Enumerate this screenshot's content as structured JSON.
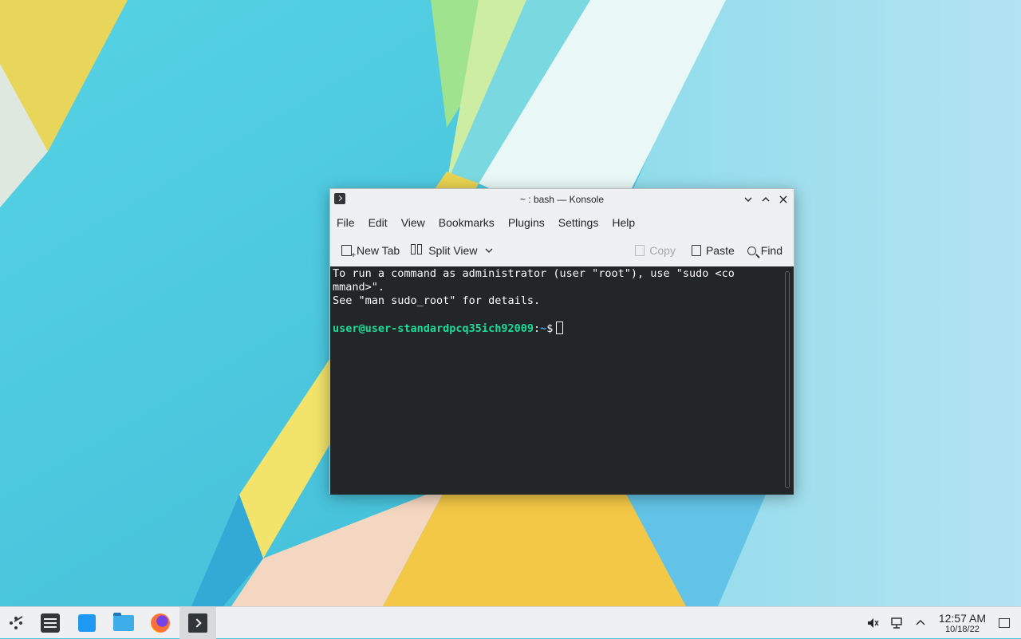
{
  "window": {
    "title": "~ : bash — Konsole",
    "app_icon": "konsole-icon"
  },
  "menubar": {
    "items": [
      "File",
      "Edit",
      "View",
      "Bookmarks",
      "Plugins",
      "Settings",
      "Help"
    ]
  },
  "toolbar": {
    "new_tab": "New Tab",
    "split_view": "Split View",
    "copy": "Copy",
    "paste": "Paste",
    "find": "Find"
  },
  "terminal": {
    "lines": [
      "To run a command as administrator (user \"root\"), use \"sudo <co",
      "mmand>\".",
      "See \"man sudo_root\" for details.",
      ""
    ],
    "prompt_user": "user@user-standardpcq35ich92009",
    "prompt_sep": ":",
    "prompt_path": "~",
    "prompt_symbol": "$"
  },
  "taskbar": {
    "items": [
      "application-launcher-icon",
      "system-settings-icon",
      "discover-store-icon",
      "dolphin-file-manager-icon",
      "firefox-icon",
      "konsole-icon"
    ],
    "active": "konsole-icon"
  },
  "tray": {
    "time": "12:57 AM",
    "date": "10/18/22",
    "icons": [
      "volume-muted-icon",
      "network-icon",
      "expand-tray-icon",
      "show-desktop-icon"
    ]
  },
  "colors": {
    "terminal_bg": "#232627",
    "prompt_user": "#1cdc9a",
    "prompt_path": "#3daee9",
    "window_bg": "#eff0f1"
  }
}
